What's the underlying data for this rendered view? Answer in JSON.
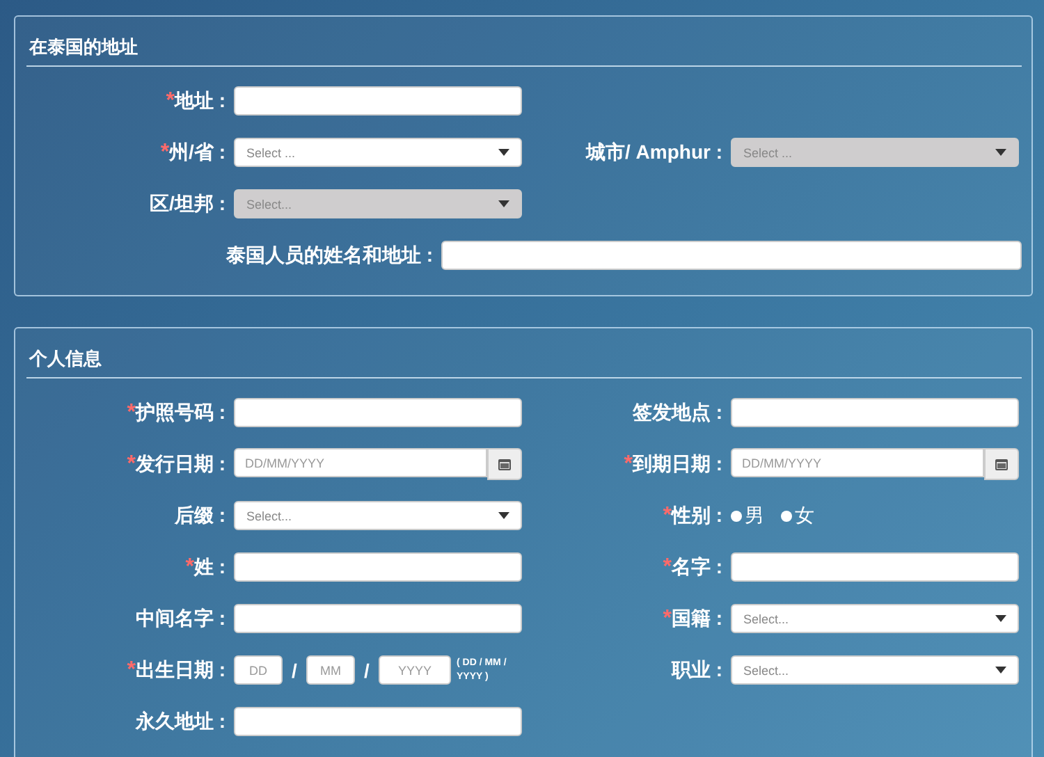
{
  "sections": [
    {
      "title": "在泰国的地址",
      "rows": [
        {
          "kind": "pair",
          "items": [
            {
              "mark": "*",
              "label": "地址 :",
              "kind": "text"
            }
          ]
        },
        {
          "kind": "pair",
          "items": [
            {
              "mark": "*",
              "label": "州/省 :",
              "kind": "select",
              "placeholder": "Select ...",
              "disabled": false
            },
            {
              "label": "城市/ Amphur :",
              "kind": "select",
              "placeholder": "Select ...",
              "disabled": true
            }
          ]
        },
        {
          "kind": "pair",
          "items": [
            {
              "label": "区/坦邦 :",
              "kind": "select",
              "placeholder": "Select...",
              "disabled": true
            }
          ]
        },
        {
          "kind": "wide",
          "items": [
            {
              "label": "泰国人员的姓名和地址 :",
              "kind": "text"
            }
          ]
        }
      ]
    },
    {
      "title": "个人信息",
      "rows": [
        {
          "kind": "pair",
          "items": [
            {
              "mark": "*",
              "label": "护照号码 :",
              "kind": "text"
            },
            {
              "label": "签发地点 :",
              "kind": "text"
            }
          ]
        },
        {
          "kind": "pair",
          "items": [
            {
              "mark": "*",
              "label": "发行日期 :",
              "kind": "date",
              "placeholder": "DD/MM/YYYY"
            },
            {
              "mark": "*",
              "label": "到期日期 :",
              "kind": "date",
              "placeholder": "DD/MM/YYYY"
            }
          ]
        },
        {
          "kind": "pair",
          "items": [
            {
              "label": "后缀 :",
              "kind": "select",
              "placeholder": "Select...",
              "disabled": false
            },
            {
              "mark": "*",
              "label": "性别 :",
              "kind": "radio",
              "options": [
                {
                  "label": "男",
                  "selected": false
                },
                {
                  "label": "女",
                  "selected": false
                }
              ]
            }
          ]
        },
        {
          "kind": "pair",
          "items": [
            {
              "mark": "*",
              "label": "姓 :",
              "kind": "text"
            },
            {
              "mark": "*",
              "label": "名字 :",
              "kind": "text"
            }
          ]
        },
        {
          "kind": "pair",
          "items": [
            {
              "label": "中间名字 :",
              "kind": "text"
            },
            {
              "mark": "*",
              "label": "国籍 :",
              "kind": "select",
              "placeholder": "Select...",
              "disabled": false
            }
          ]
        },
        {
          "kind": "pair",
          "items": [
            {
              "mark": "*",
              "label": "出生日期 :",
              "kind": "dob",
              "parts": [
                {
                  "placeholder": "DD"
                },
                {
                  "placeholder": "MM"
                },
                {
                  "placeholder": "YYYY"
                }
              ],
              "separators": [
                "/",
                "/"
              ],
              "hint": "( DD / MM / YYYY )"
            },
            {
              "label": "职业 :",
              "kind": "select",
              "placeholder": "Select...",
              "disabled": false
            }
          ]
        },
        {
          "kind": "pair",
          "items": [
            {
              "label": "永久地址 :",
              "kind": "text"
            }
          ]
        }
      ]
    }
  ]
}
